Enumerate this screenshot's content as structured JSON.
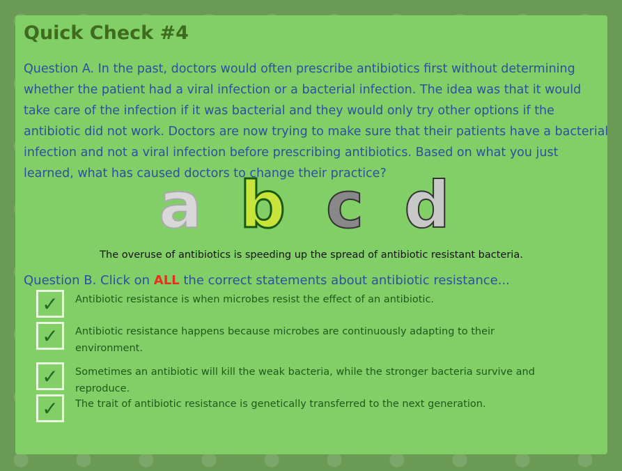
{
  "title": "Quick Check #4",
  "question_a": {
    "text": "Question A. In the past, doctors would often prescribe antibiotics first without determining whether the patient had a viral infection or a bacterial infection. The idea was that it would take care of the infection if it was bacterial and they would only try other options if the antibiotic did not work. Doctors are now trying to make sure that their patients have a bacterial infection and not a viral infection before prescribing antibiotics. Based on what you just learned, what has caused doctors to change their practice?",
    "options": [
      "a",
      "b",
      "c",
      "d"
    ],
    "selected": "b",
    "answer_text": "The overuse of antibiotics is speeding up the spread of antibiotic resistant bacteria."
  },
  "question_b": {
    "prefix": "Question B. Click on ",
    "emphasis": "ALL",
    "suffix": " the correct statements about antibiotic resistance...",
    "options": [
      {
        "text": "Antibiotic resistance is when microbes resist the effect of an antibiotic.",
        "checked": true,
        "mark": "✓"
      },
      {
        "text": "Antibiotic resistance happens because microbes are continuously adapting to their environment.",
        "checked": true,
        "mark": "✓"
      },
      {
        "text": "Sometimes an antibiotic will kill the weak bacteria, while the stronger bacteria survive and reproduce.",
        "checked": true,
        "mark": "✓"
      },
      {
        "text": "The trait of antibiotic resistance is genetically transferred to the next generation.",
        "checked": true,
        "mark": "✓"
      }
    ]
  },
  "colors": {
    "accent": "#e8301c",
    "question": "#2c4f9e",
    "title": "#3e6b1d",
    "panel": "#82cf68"
  }
}
